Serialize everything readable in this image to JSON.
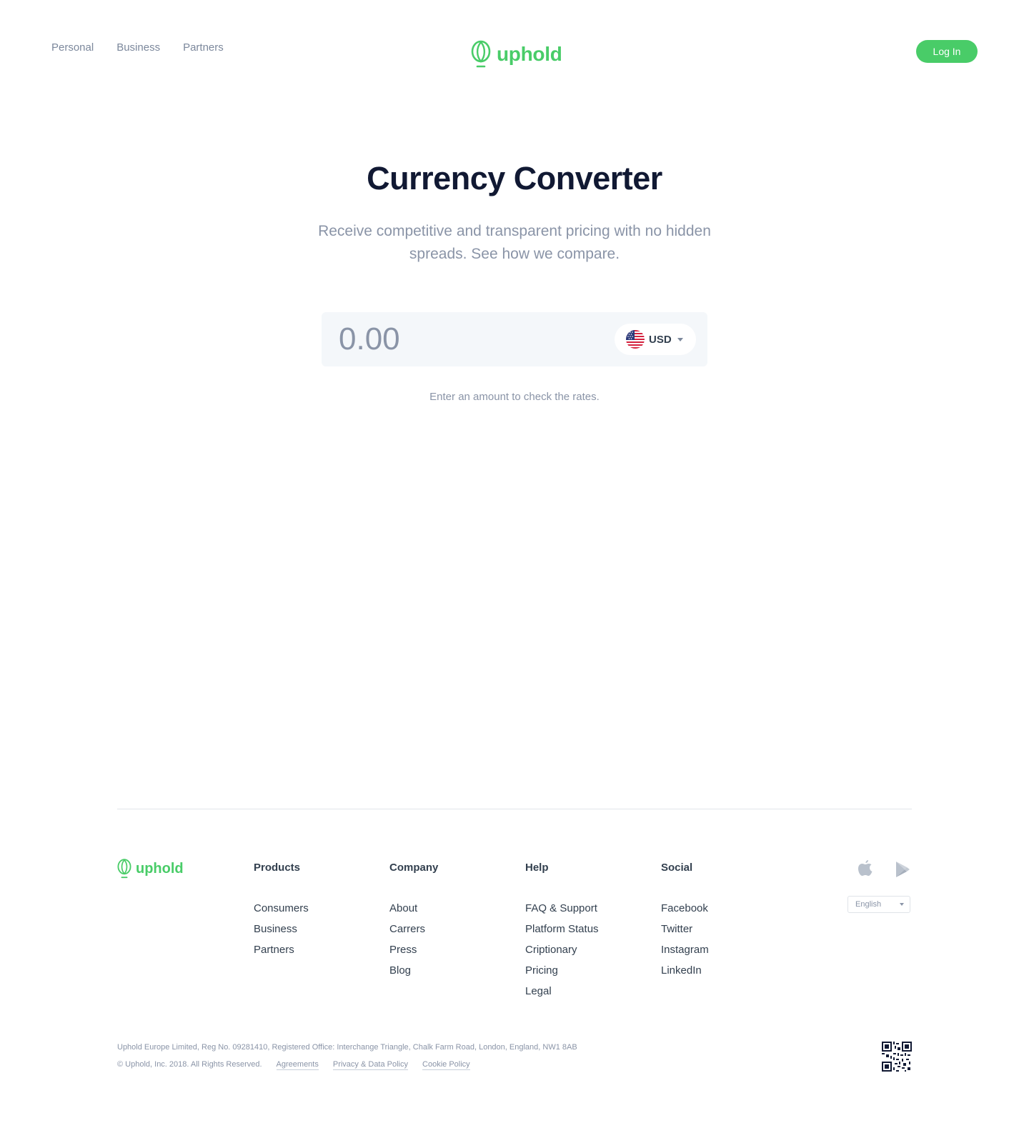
{
  "header": {
    "nav": [
      "Personal",
      "Business",
      "Partners"
    ],
    "logo_text": "uphold",
    "login_label": "Log In"
  },
  "hero": {
    "title": "Currency Converter",
    "subtitle": "Receive competitive and transparent pricing with no hidden spreads. See how we compare."
  },
  "converter": {
    "amount_placeholder": "0.00",
    "currency_code": "USD",
    "currency_flag": "us-flag-icon",
    "hint": "Enter an amount to check the rates."
  },
  "footer": {
    "logo_text": "uphold",
    "columns": [
      {
        "title": "Products",
        "links": [
          "Consumers",
          "Business",
          "Partners"
        ]
      },
      {
        "title": "Company",
        "links": [
          "About",
          "Carrers",
          "Press",
          "Blog"
        ]
      },
      {
        "title": "Help",
        "links": [
          "FAQ & Support",
          "Platform Status",
          "Criptionary",
          "Pricing",
          "Legal"
        ]
      },
      {
        "title": "Social",
        "links": [
          "Facebook",
          "Twitter",
          "Instagram",
          "LinkedIn"
        ]
      }
    ],
    "language": "English",
    "legal_line": "Uphold Europe Limited, Reg No. 09281410, Registered Office: Interchange Triangle, Chalk Farm Road, London, England, NW1 8AB",
    "copyright": "© Uphold, Inc. 2018. All Rights Reserved.",
    "legal_links": [
      "Agreements",
      "Privacy & Data Policy",
      "Cookie Policy"
    ],
    "icons": [
      "apple-icon",
      "google-play-icon",
      "qr-code-icon"
    ]
  },
  "colors": {
    "brand_green": "#49cc68",
    "title_navy": "#111933",
    "muted_gray": "#8a94a7",
    "input_bg": "#f4f7fa"
  }
}
